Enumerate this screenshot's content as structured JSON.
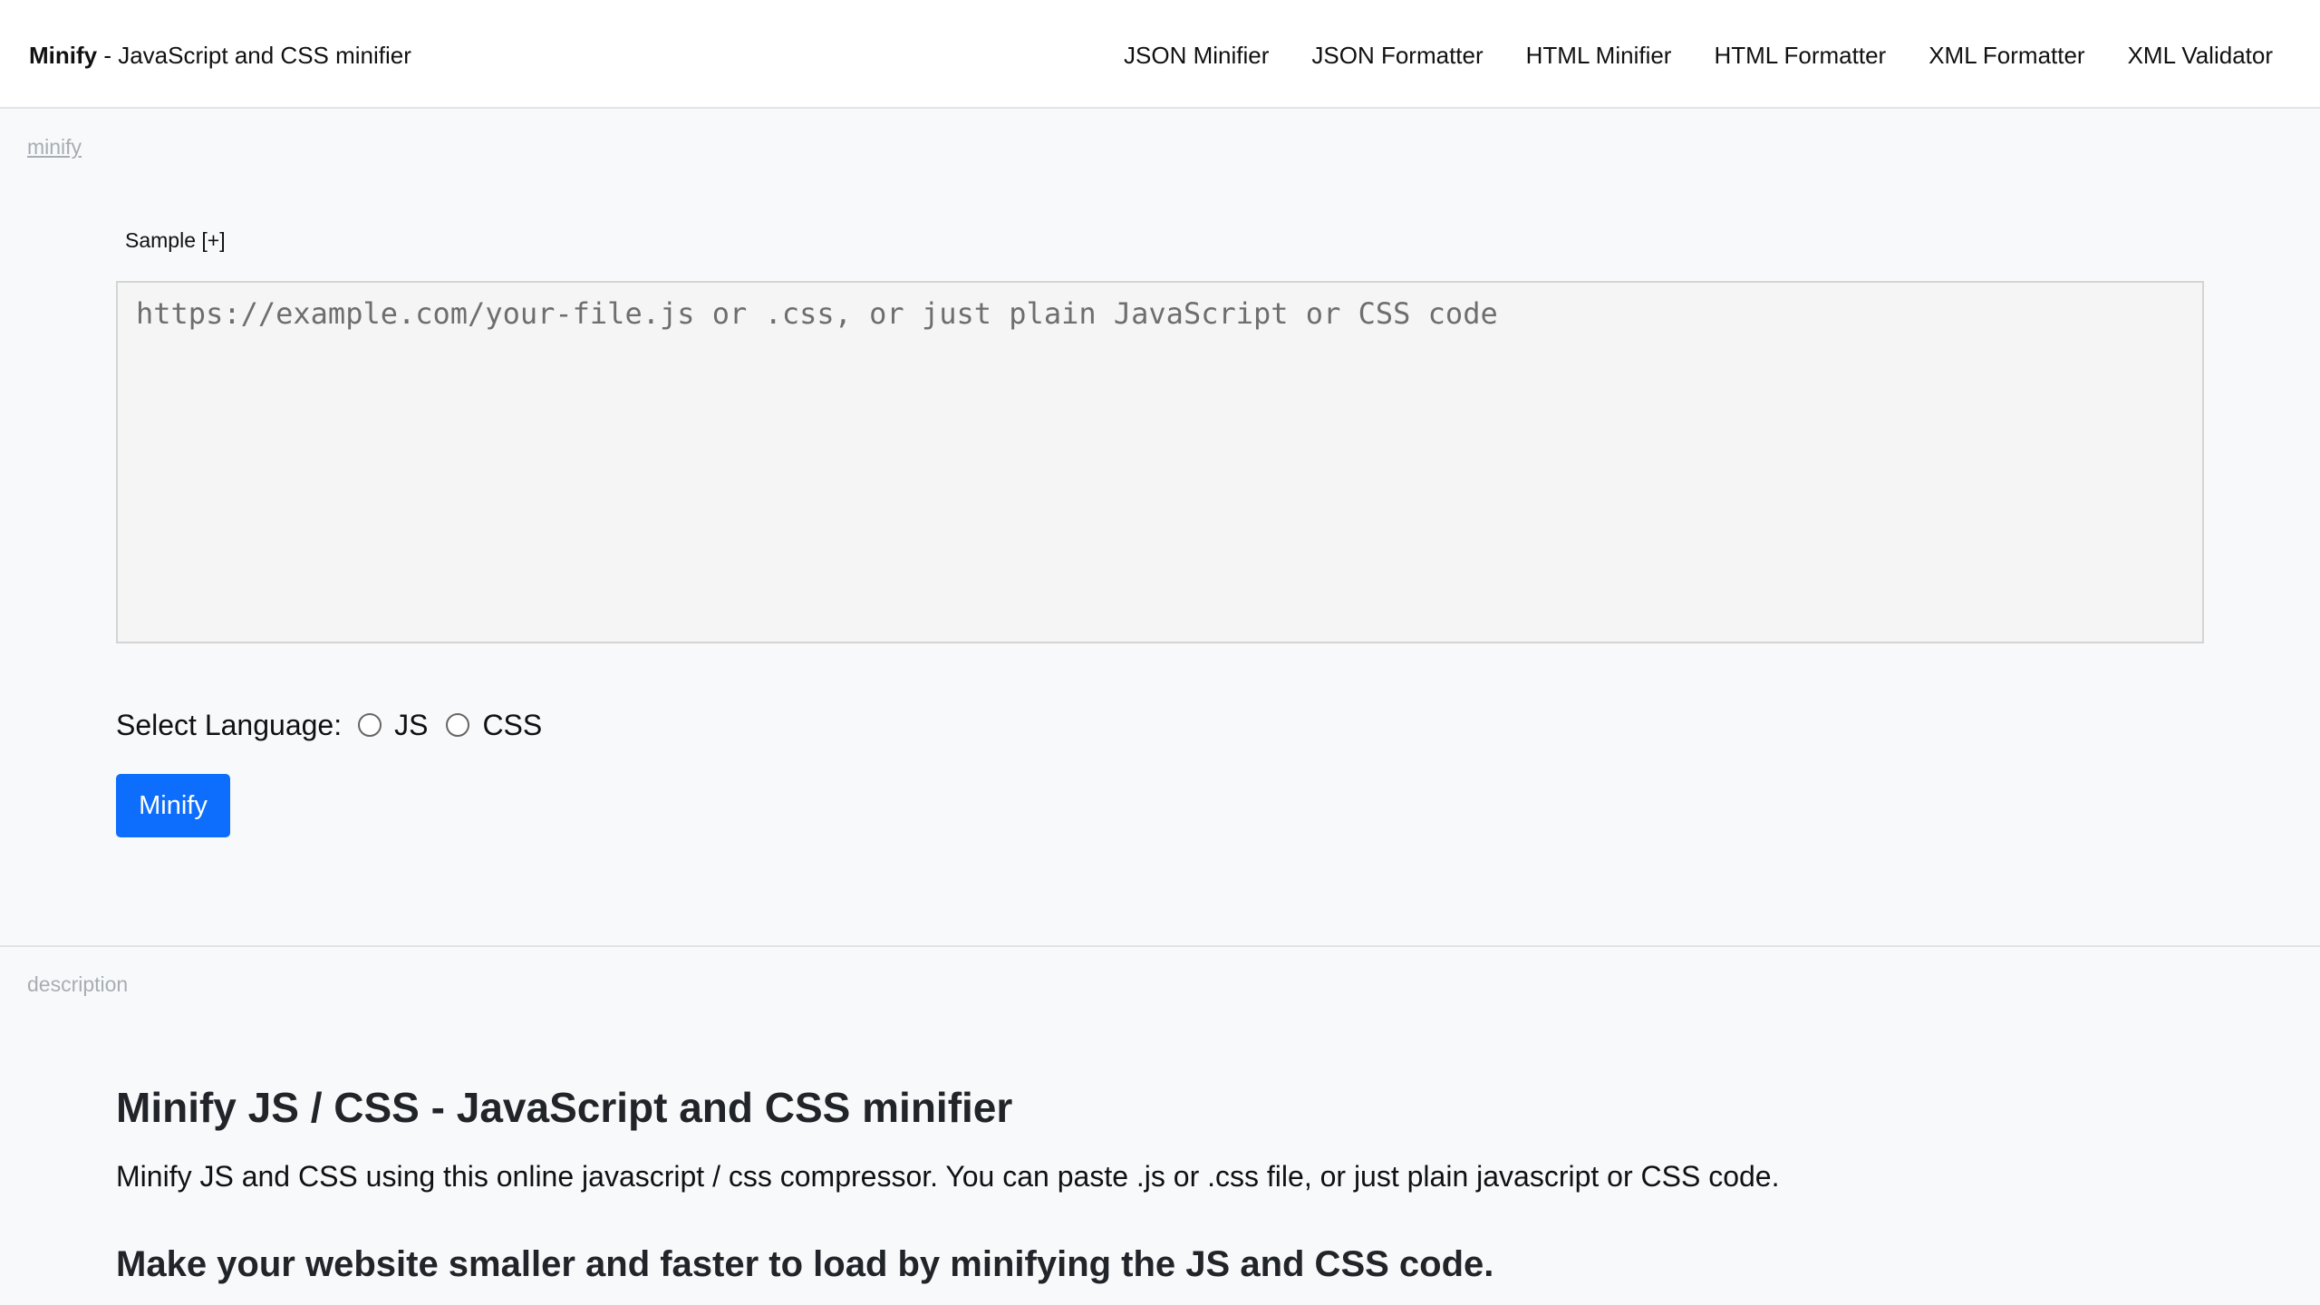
{
  "navbar": {
    "brand_name": "Minify",
    "brand_tagline": " - JavaScript and CSS minifier",
    "links": [
      {
        "label": "JSON Minifier"
      },
      {
        "label": "JSON Formatter"
      },
      {
        "label": "HTML Minifier"
      },
      {
        "label": "HTML Formatter"
      },
      {
        "label": "XML Formatter"
      },
      {
        "label": "XML Validator"
      }
    ]
  },
  "minify_section": {
    "label": "minify",
    "sample_toggle": "Sample [+]",
    "input": {
      "value": "",
      "placeholder": "https://example.com/your-file.js or .css, or just plain JavaScript or CSS code"
    },
    "language": {
      "label": "Select Language:",
      "options": [
        {
          "label": "JS",
          "checked": false
        },
        {
          "label": "CSS",
          "checked": false
        }
      ]
    },
    "button_label": "Minify",
    "button_color": "#0d6efd"
  },
  "description_section": {
    "label": "description",
    "heading_strong": "Minify JS / CSS",
    "heading_rest": " - JavaScript and CSS minifier",
    "text": "Minify JS and CSS using this online javascript / css compressor. You can paste .js or .css file, or just plain javascript or CSS code.",
    "subheading": "Make your website smaller and faster to load by minifying the JS and CSS code."
  }
}
